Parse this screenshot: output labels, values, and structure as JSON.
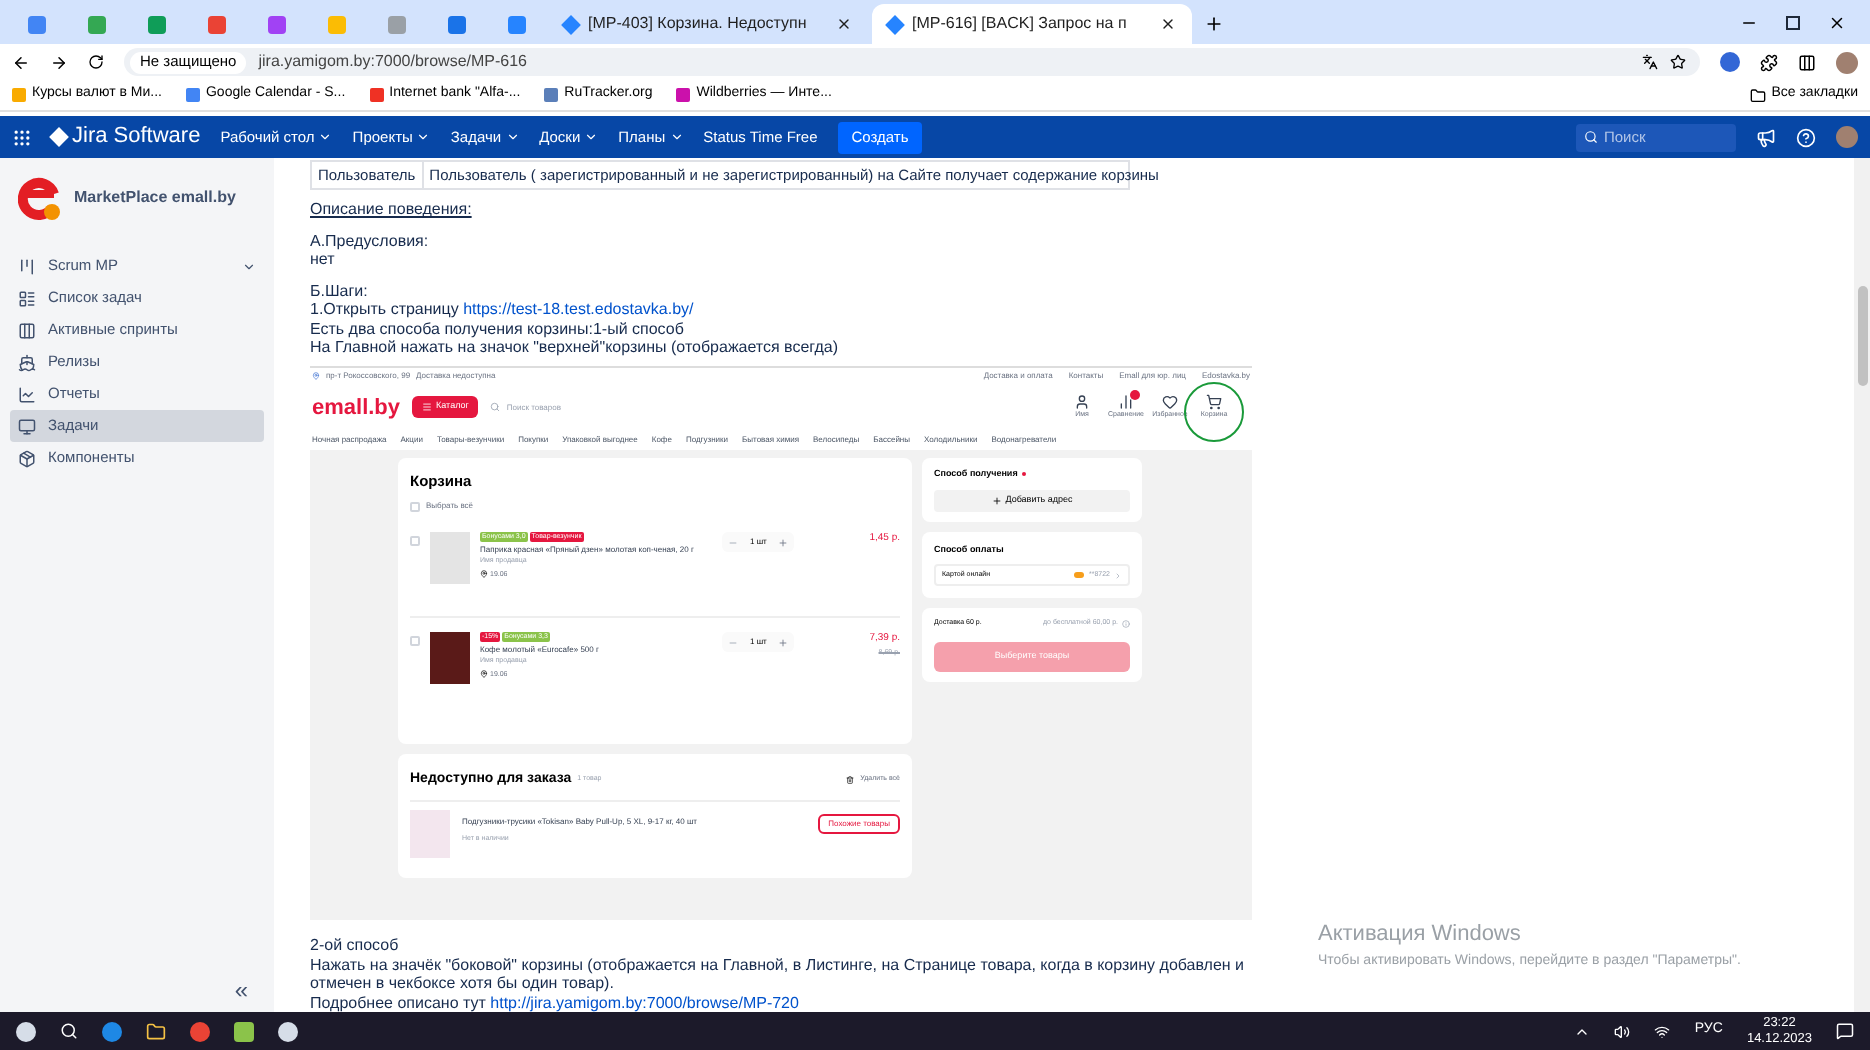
{
  "browser": {
    "tabs": [
      {
        "kind": "icon",
        "color": "#4285f4",
        "selected": false
      },
      {
        "kind": "icon",
        "color": "#34a853",
        "selected": false
      },
      {
        "kind": "icon",
        "color": "#0f9d58",
        "selected": false
      },
      {
        "kind": "icon",
        "color": "#ea4335",
        "selected": false
      },
      {
        "kind": "icon",
        "color": "#a142f4",
        "selected": false
      },
      {
        "kind": "icon",
        "color": "#fbbc04",
        "selected": false
      },
      {
        "kind": "icon",
        "color": "#9aa0a6",
        "selected": false
      },
      {
        "kind": "icon",
        "color": "#1a73e8",
        "selected": false
      },
      {
        "kind": "icon",
        "color": "#2684ff",
        "selected": false
      },
      {
        "kind": "title",
        "title": "[MP-403] Корзина. Недоступн",
        "selected": false
      },
      {
        "kind": "title",
        "title": "[MP-616] [BACK] Запрос на п",
        "selected": true
      }
    ],
    "security": "Не защищено",
    "url": "jira.yamigom.by:7000/browse/MP-616",
    "bookmarks": [
      {
        "label": "Курсы валют в Ми...",
        "color": "#f9ab00"
      },
      {
        "label": "Google Calendar - S...",
        "color": "#4285f4"
      },
      {
        "label": "Internet bank \"Alfa-...",
        "color": "#ef3124"
      },
      {
        "label": "RuTracker.org",
        "color": "#5b7fb9"
      },
      {
        "label": "Wildberries — Инте...",
        "color": "#cb11ab"
      }
    ],
    "all_bookmarks": "Все закладки"
  },
  "jira_nav": {
    "brand": "Jira Software",
    "menus": [
      {
        "label": "Рабочий стол",
        "dropdown": true
      },
      {
        "label": "Проекты",
        "dropdown": true
      },
      {
        "label": "Задачи",
        "dropdown": true
      },
      {
        "label": "Доски",
        "dropdown": true
      },
      {
        "label": "Планы",
        "dropdown": true
      },
      {
        "label": "Status Time Free",
        "dropdown": false
      }
    ],
    "create": "Создать",
    "search_placeholder": "Поиск"
  },
  "sidebar": {
    "project": "MarketPlace emall.by",
    "items": [
      {
        "label": "Scrum MP",
        "expandable": true,
        "selected": false
      },
      {
        "label": "Список задач",
        "expandable": false,
        "selected": false
      },
      {
        "label": "Активные спринты",
        "expandable": false,
        "selected": false
      },
      {
        "label": "Релизы",
        "expandable": false,
        "selected": false
      },
      {
        "label": "Отчеты",
        "expandable": false,
        "selected": false
      },
      {
        "label": "Задачи",
        "expandable": false,
        "selected": true
      },
      {
        "label": "Компоненты",
        "expandable": false,
        "selected": false
      }
    ],
    "collapse": "«"
  },
  "issue": {
    "table_row": [
      "Пользователь",
      "Пользователь ( зарегистрированный и не зарегистрированный) на Сайте получает содержание корзины"
    ],
    "paragraphs_top": [
      [
        {
          "text": "Описание поведения:",
          "underlined": true
        }
      ],
      [
        {
          "text": "А.Предусловия:",
          "underlined": false
        },
        {
          "text": "нет",
          "underlined": false
        }
      ],
      [
        {
          "text": "Б.Шаги:",
          "underlined": false
        },
        {
          "text": "1.Открыть страницу",
          "link": "https://test-18.test.edostavka.by/",
          "underlined": false
        },
        {
          "text": "Есть два способа получения корзины:1-ый способ",
          "underlined": false
        },
        {
          "text": "На Главной нажать на значок \"верхней\"корзины (отображается всегда)",
          "underlined": false
        }
      ]
    ],
    "paragraphs_bottom": [
      [
        {
          "text": "2-ой способ",
          "underlined": false
        },
        {
          "text": "Нажать на значёк \"боковой\" корзины (отображается на Главной, в Листинге, на Странице товара, когда в корзину добавлен и отмечен в чекбоксе хотя бы один товар).",
          "underlined": false
        },
        {
          "text": "Подробнее описано тут",
          "link": "http://jira.yamigom.by:7000/browse/MP-720",
          "underlined": false
        }
      ]
    ]
  },
  "screenshot": {
    "location": "пр-т Рокоссовского, 99",
    "delivery_note": "Доставка недоступна",
    "top_links": [
      "Доставка и оплата",
      "Контакты",
      "Emall для юр. лиц",
      "Edostavka.by"
    ],
    "logo": "emall.by",
    "catalog": "Каталог",
    "search_placeholder": "Поиск товаров",
    "header_icons": [
      {
        "kind": "user",
        "label": "Имя",
        "badge": false,
        "circled": false
      },
      {
        "kind": "compare",
        "label": "Сравнение",
        "badge": true,
        "circled": false
      },
      {
        "kind": "heart",
        "label": "Избранное",
        "badge": false,
        "circled": false
      },
      {
        "kind": "cart",
        "label": "Корзина",
        "badge": false,
        "circled": true
      }
    ],
    "categories": [
      "Ночная распродажа",
      "Акции",
      "Товары-везунчики",
      "Покупки",
      "Упаковкой выгоднее",
      "Кофе",
      "Подгузники",
      "Бытовая химия",
      "Велосипеды",
      "Бассейны",
      "Холодильники",
      "Водонагреватели"
    ],
    "cart": {
      "title": "Корзина",
      "select_all": "Выбрать всё",
      "checked_all": false,
      "items": [
        {
          "badges": [
            {
              "text": "Бонусами 3,0",
              "color": "#8bc34a"
            },
            {
              "text": "Товар-везунчик",
              "color": "#e5173f"
            }
          ],
          "name": "Паприка красная «Пряный дзен» молотая коп-ченая, 20 г",
          "seller": "Имя продавца",
          "date": "19.06",
          "qty": "1 шт",
          "price": "1,45 р.",
          "checked": false
        },
        {
          "badges": [
            {
              "text": "-15%",
              "color": "#e5173f"
            },
            {
              "text": "Бонусами 3,3",
              "color": "#8bc34a"
            }
          ],
          "name": "Кофе молотый «Eurocafe» 500 г",
          "seller": "Имя продавца",
          "date": "19.06",
          "qty": "1 шт",
          "price": "7,39 р.",
          "old_price": "8,69 р.",
          "checked": false
        }
      ]
    },
    "unavailable": {
      "title": "Недоступно для заказа",
      "count": "1 товар",
      "delete_all": "Удалить всё",
      "item": {
        "name": "Подгузники-трусики «Tokisan» Baby Pull-Up, 5 XL, 9-17 кг, 40 шт",
        "status": "Нет в наличии",
        "button": "Похожие товары"
      }
    },
    "receipt": {
      "title": "Способ получения",
      "required": true,
      "add_address": "Добавить адрес"
    },
    "payment": {
      "title": "Способ оплаты",
      "method": "Картой онлайн",
      "card": "**8722"
    },
    "summary": {
      "delivery": "Доставка 60 р.",
      "free_hint": "до бесплатной 60,00 р.",
      "button": "Выберите товары",
      "button_disabled": true
    }
  },
  "windows_activation": {
    "title": "Активация Windows",
    "text": "Чтобы активировать Windows, перейдите в раздел \"Параметры\"."
  },
  "taskbar": {
    "language": "РУС",
    "time": "23:22",
    "date": "14.12.2023"
  }
}
